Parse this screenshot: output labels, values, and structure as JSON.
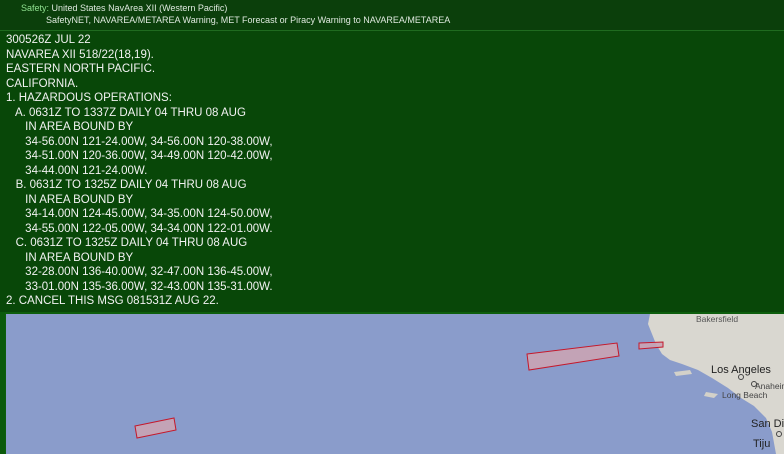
{
  "header": {
    "category_label": "Safety:",
    "area_name": "United States NavArea XII (Western Pacific)",
    "subtitle": "SafetyNET, NAVAREA/METAREA Warning, MET Forecast or Piracy Warning to NAVAREA/METAREA"
  },
  "message": {
    "lines": [
      "300526Z JUL 22",
      "NAVAREA XII 518/22(18,19).",
      "EASTERN NORTH PACIFIC.",
      "CALIFORNIA.",
      "1. HAZARDOUS OPERATIONS:",
      "   A. 0631Z TO 1337Z DAILY 04 THRU 08 AUG",
      "      IN AREA BOUND BY",
      "      34-56.00N 121-24.00W, 34-56.00N 120-38.00W,",
      "      34-51.00N 120-36.00W, 34-49.00N 120-42.00W,",
      "      34-44.00N 121-24.00W.",
      "   B. 0631Z TO 1325Z DAILY 04 THRU 08 AUG",
      "      IN AREA BOUND BY",
      "      34-14.00N 124-45.00W, 34-35.00N 124-50.00W,",
      "      34-55.00N 122-05.00W, 34-34.00N 122-01.00W.",
      "   C. 0631Z TO 1325Z DAILY 04 THRU 08 AUG",
      "      IN AREA BOUND BY",
      "      32-28.00N 136-40.00W, 32-47.00N 136-45.00W,",
      "      33-01.00N 135-36.00W, 32-43.00N 135-31.00W.",
      "2. CANCEL THIS MSG 081531Z AUG 22."
    ]
  },
  "map": {
    "cities": {
      "bakersfield": "Bakersfield",
      "los_angeles": "Los Angeles",
      "anaheim": "Anaheim",
      "long_beach": "Long Beach",
      "san_diego": "San Di",
      "tijuana": "Tiju"
    },
    "colors": {
      "ocean": "#8a9ccb",
      "land": "#d9d7d0",
      "zone_stroke": "#c4182b",
      "zone_fill": "#c9a4b4"
    }
  }
}
